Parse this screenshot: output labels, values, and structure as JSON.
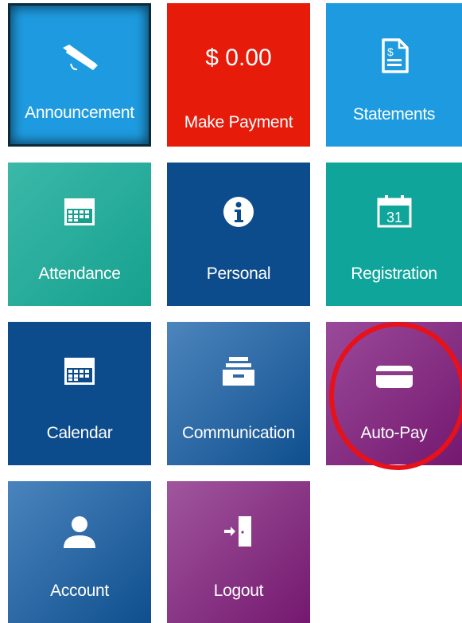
{
  "tiles": {
    "announcement": {
      "label": "Announcement",
      "icon": "megaphone-icon"
    },
    "make_payment": {
      "label": "Make Payment",
      "amount": "$ 0.00"
    },
    "statements": {
      "label": "Statements",
      "icon": "document-dollar-icon"
    },
    "attendance": {
      "label": "Attendance",
      "icon": "calendar-grid-icon"
    },
    "personal": {
      "label": "Personal",
      "icon": "info-icon"
    },
    "registration": {
      "label": "Registration",
      "icon": "calendar-31-icon",
      "day": "31"
    },
    "calendar": {
      "label": "Calendar",
      "icon": "calendar-grid-icon"
    },
    "communication": {
      "label": "Communication",
      "icon": "inbox-tray-icon"
    },
    "auto_pay": {
      "label": "Auto-Pay",
      "icon": "credit-card-icon"
    },
    "account": {
      "label": "Account",
      "icon": "user-icon"
    },
    "logout": {
      "label": "Logout",
      "icon": "door-exit-icon"
    }
  },
  "colors": {
    "blue": "#1e9be0",
    "red": "#e61b0a",
    "teal": "#16a18f",
    "navy": "#0d4c8c",
    "purple": "#74186f",
    "highlight": "#e6111a"
  }
}
